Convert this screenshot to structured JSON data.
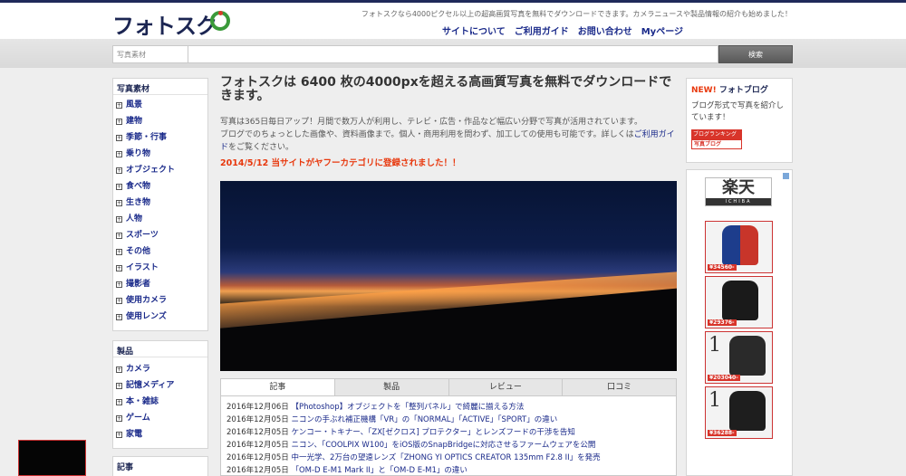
{
  "header": {
    "logo_text": "フォトスク",
    "tagline": "フォトスクなら4000ピクセル以上の超高画質写真を無料でダウンロードできます。カメラニュースや製品情報の紹介も始めました！",
    "nav": [
      "サイトについて",
      "ご利用ガイド",
      "お問い合わせ",
      "Myページ"
    ]
  },
  "search": {
    "category": "写真素材",
    "button": "検索"
  },
  "sidebar": {
    "photo": {
      "title": "写真素材",
      "items": [
        "風景",
        "建物",
        "季節・行事",
        "乗り物",
        "オブジェクト",
        "食べ物",
        "生き物",
        "人物",
        "スポーツ",
        "その他",
        "イラスト",
        "撮影者",
        "使用カメラ",
        "使用レンズ"
      ]
    },
    "products": {
      "title": "製品",
      "items": [
        "カメラ",
        "記憶メディア",
        "本・雑誌",
        "ゲーム",
        "家電"
      ]
    },
    "articles": {
      "title": "記事"
    }
  },
  "main": {
    "title": "フォトスクは 6400 枚の4000pxを超える高画質写真を無料でダウンロードできます。",
    "intro_1": "写真は365日毎日アップ！月間で数万人が利用し、テレビ・広告・作品など幅広い分野で写真が活用されています。",
    "intro_2a": "ブログでのちょっとした画像や、資料画像まで。個人・商用利用を問わず、加工しての使用も可能です。詳しくは",
    "intro_link": "ご利用ガイド",
    "intro_2b": "をご覧ください。",
    "notice": "2014/5/12 当サイトがヤフーカテゴリに登録されました！！",
    "tabs": [
      "記事",
      "製品",
      "レビュー",
      "口コミ"
    ],
    "news": [
      {
        "date": "2016年12月06日",
        "title": "【Photoshop】オブジェクトを「整列パネル」で綺麗に揃える方法"
      },
      {
        "date": "2016年12月05日",
        "title": "ニコンの手ぶれ補正機構「VR」の「NORMAL」「ACTIVE」「SPORT」の違い"
      },
      {
        "date": "2016年12月05日",
        "title": "ケンコー・トキナー、「ZX[ゼクロス] プロテクター」とレンズフードの干渉を告知"
      },
      {
        "date": "2016年12月05日",
        "title": "ニコン、「COOLPIX W100」をiOS版のSnapBridgeに対応させるファームウェアを公開"
      },
      {
        "date": "2016年12月05日",
        "title": "中一光学、2万台の望遠レンズ「ZHONG YI OPTICS CREATOR 135mm F2.8 II」を発売"
      },
      {
        "date": "2016年12月05日",
        "title": "「OM-D E-M1 Mark II」と「OM-D E-M1」の違い"
      }
    ]
  },
  "right": {
    "blog_new": "NEW!",
    "blog_name": "フォトブログ",
    "blog_desc": "ブログ形式で写真を紹介しています！",
    "badge_1": "ブログランキング",
    "badge_2": "写真ブログ",
    "ad_brand": "楽天",
    "ad_brand_sub": "ICHIBA",
    "ad_prices": [
      "¥34560-",
      "¥29376-",
      "¥203040-",
      "¥36288-"
    ],
    "ad_one": "1"
  }
}
